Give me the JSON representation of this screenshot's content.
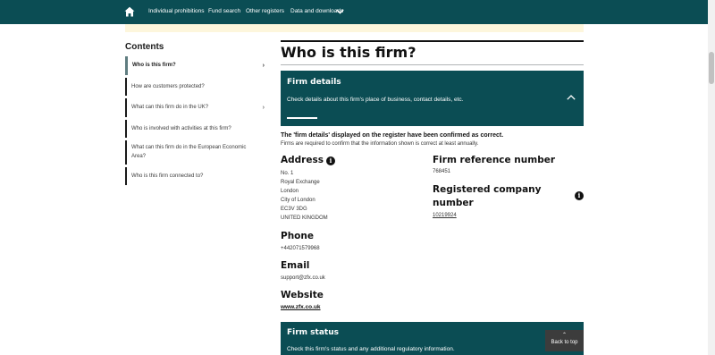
{
  "nav": {
    "items": [
      "Individual prohibitions",
      "Fund search",
      "Other registers",
      "Data and downloads"
    ]
  },
  "contents": {
    "title": "Contents",
    "items": [
      "Who is this firm?",
      "How are customers protected?",
      "What can this firm do in the UK?",
      "Who is involved with activities at this firm?",
      "What can this firm do in the European Economic Area?",
      "Who is this firm connected to?"
    ]
  },
  "main": {
    "title": "Who is this firm?",
    "firm_details": {
      "title": "Firm details",
      "description": "Check details about this firm's place of business, contact details, etc."
    },
    "confirmed": "The 'firm details' displayed on the register have been confirmed as correct.",
    "confirmed_sub": "Firms are required to confirm that the information shown is correct at least annually.",
    "address": {
      "label": "Address",
      "lines": [
        "No. 1",
        "Royal Exchange",
        "London",
        "City of London",
        "EC3V 3DG",
        "UNITED KINGDOM"
      ]
    },
    "phone": {
      "label": "Phone",
      "value": "+442071579968"
    },
    "email": {
      "label": "Email",
      "value": "support@zfx.co.uk"
    },
    "website": {
      "label": "Website",
      "value": "www.zfx.co.uk"
    },
    "frn": {
      "label": "Firm reference number",
      "value": "768451"
    },
    "company": {
      "label_line1": "Registered company",
      "label_line2": "number",
      "value": "10219924"
    },
    "firm_status": {
      "title": "Firm status",
      "description": "Check this firm's status and any additional regulatory information."
    }
  },
  "back_to_top": "Back to top",
  "colors": {
    "nav_bg": "#0b4d54",
    "panel_bg": "#0b4d54",
    "banner_bg": "#fdf6dc"
  }
}
